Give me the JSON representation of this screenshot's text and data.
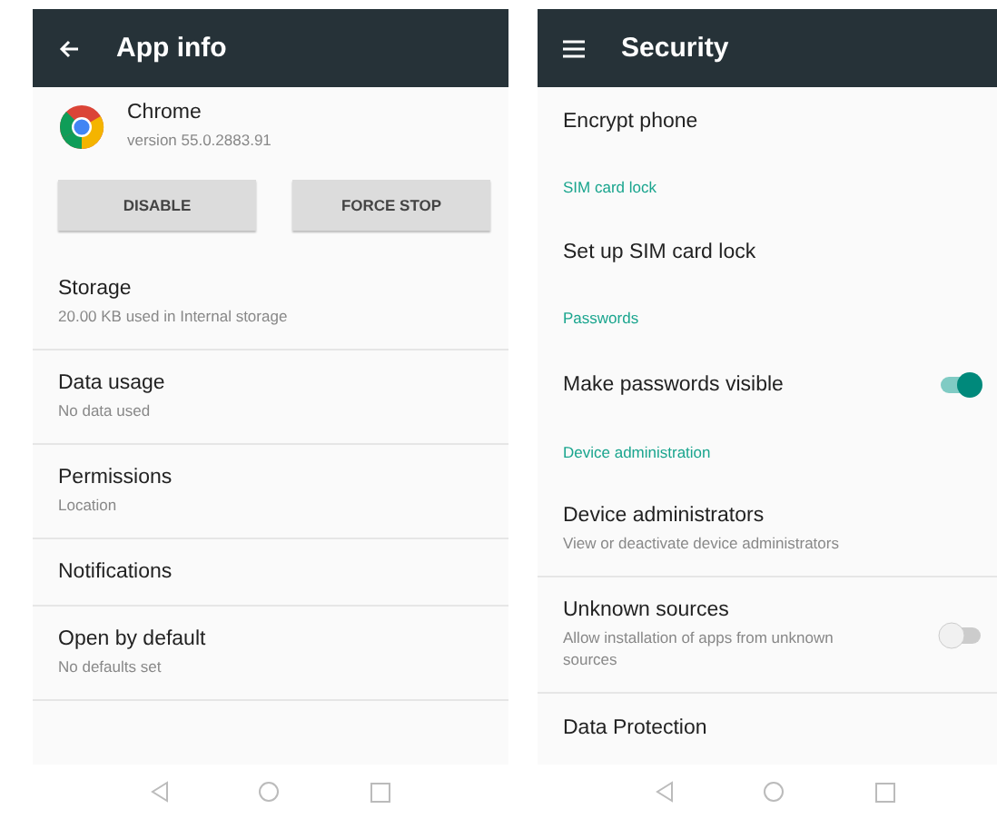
{
  "phones": [
    {
      "header": {
        "kind": "back",
        "title": "App info"
      },
      "items": [
        {
          "kind": "app",
          "title": "Chrome",
          "subtitle": "version 55.0.2883.91"
        },
        {
          "kind": "buttons",
          "buttons": [
            "DISABLE",
            "FORCE STOP"
          ]
        },
        {
          "kind": "setting",
          "title": "Storage",
          "subtitle": "20.00 KB used in Internal storage"
        },
        {
          "kind": "setting",
          "title": "Data usage",
          "subtitle": "No data used"
        },
        {
          "kind": "setting",
          "title": "Permissions",
          "subtitle": "Location"
        },
        {
          "kind": "setting",
          "title": "Notifications"
        },
        {
          "kind": "setting",
          "title": "Open by default",
          "subtitle": "No defaults set"
        }
      ]
    },
    {
      "header": {
        "kind": "menu",
        "title": "Security"
      },
      "items": [
        {
          "kind": "plain",
          "title": "Encrypt phone"
        },
        {
          "kind": "section",
          "title": "SIM card lock"
        },
        {
          "kind": "plain",
          "title": "Set up SIM card lock"
        },
        {
          "kind": "section",
          "title": "Passwords"
        },
        {
          "kind": "toggle",
          "title": "Make passwords visible",
          "on": true
        },
        {
          "kind": "section",
          "title": "Device administration"
        },
        {
          "kind": "setting",
          "title": "Device administrators",
          "subtitle": "View or deactivate device administrators"
        },
        {
          "kind": "toggle",
          "title": "Unknown sources",
          "subtitle": "Allow installation of apps from unknown sources",
          "on": false
        },
        {
          "kind": "plain",
          "title": "Data Protection"
        }
      ]
    }
  ]
}
